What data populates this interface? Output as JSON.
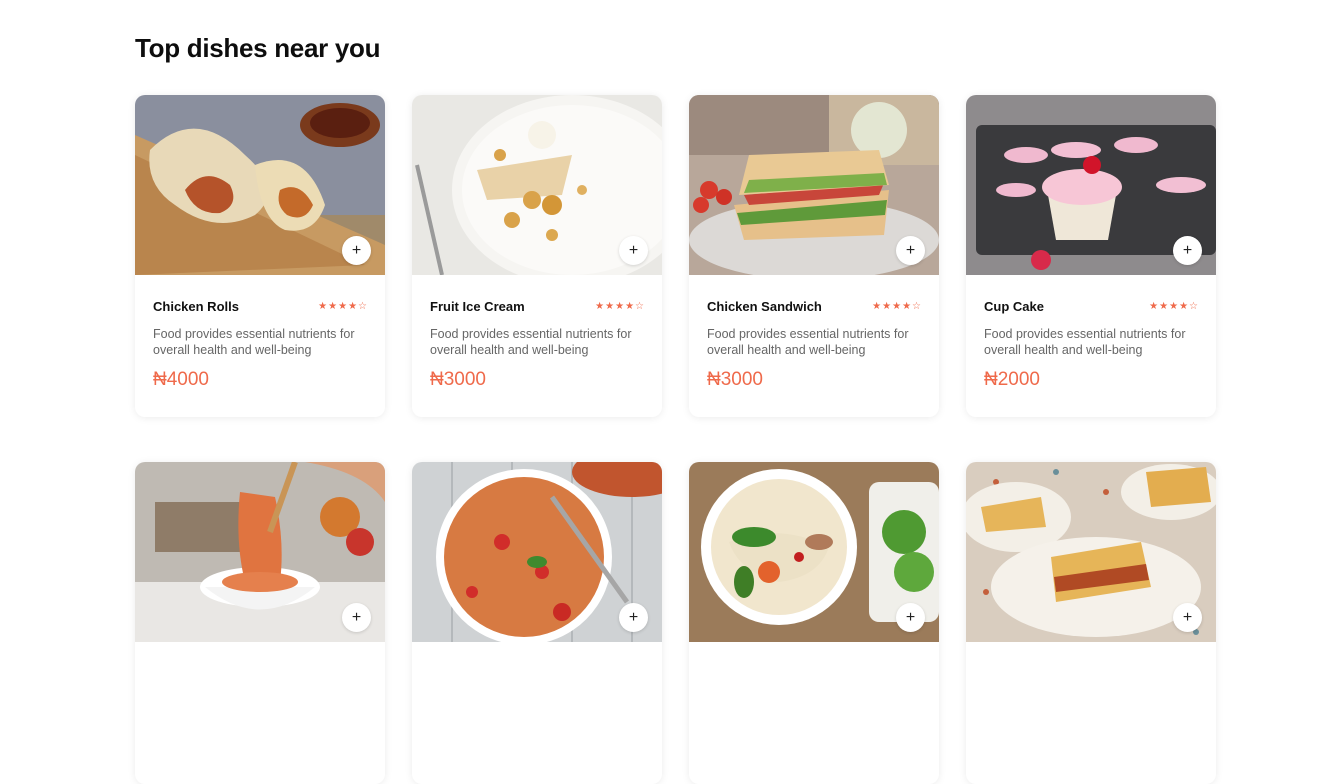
{
  "section": {
    "title": "Top dishes near you"
  },
  "colors": {
    "accent": "#ef6a4b",
    "text": "#111111",
    "muted": "#666666"
  },
  "add_icon": {
    "name": "plus-icon",
    "glyph": "+"
  },
  "dishes": [
    {
      "name": "Chicken Rolls",
      "rating": 4,
      "rating_max": 5,
      "description": "Food provides essential nutrients for overall health and well-being",
      "price": "₦4000"
    },
    {
      "name": "Fruit Ice Cream",
      "rating": 4,
      "rating_max": 5,
      "description": "Food provides essential nutrients for overall health and well-being",
      "price": "₦3000"
    },
    {
      "name": "Chicken Sandwich",
      "rating": 4,
      "rating_max": 5,
      "description": "Food provides essential nutrients for overall health and well-being",
      "price": "₦3000"
    },
    {
      "name": "Cup Cake",
      "rating": 4,
      "rating_max": 5,
      "description": "Food provides essential nutrients for overall health and well-being",
      "price": "₦2000"
    },
    {
      "name": "",
      "rating": null,
      "description": "",
      "price": ""
    },
    {
      "name": "",
      "rating": null,
      "description": "",
      "price": ""
    },
    {
      "name": "",
      "rating": null,
      "description": "",
      "price": ""
    },
    {
      "name": "",
      "rating": null,
      "description": "",
      "price": ""
    }
  ]
}
